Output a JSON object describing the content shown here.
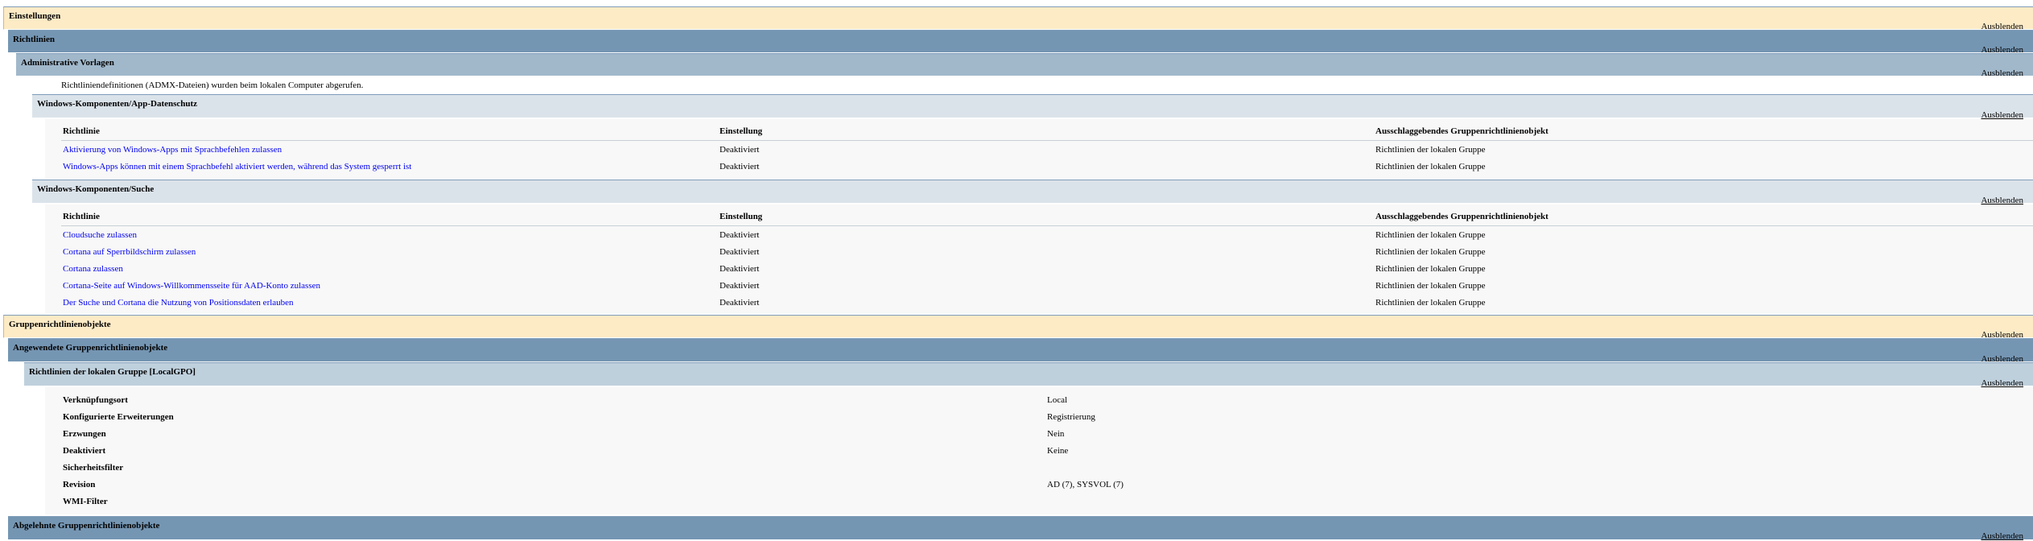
{
  "hide_label": "Ausblenden",
  "settings": {
    "title": "Einstellungen",
    "policies": {
      "title": "Richtlinien",
      "admin_templates": {
        "title": "Administrative Vorlagen",
        "note": "Richtliniendefinitionen (ADMX-Dateien) wurden beim lokalen Computer abgerufen.",
        "groups": [
          {
            "title": "Windows-Komponenten/App-Datenschutz",
            "columns": [
              "Richtlinie",
              "Einstellung",
              "Ausschlaggebendes Gruppenrichtlinienobjekt"
            ],
            "rows": [
              {
                "policy": "Aktivierung von Windows-Apps mit Sprachbefehlen zulassen",
                "setting": "Deaktiviert",
                "gpo": "Richtlinien der lokalen Gruppe"
              },
              {
                "policy": "Windows-Apps können mit einem Sprachbefehl aktiviert werden, während das System gesperrt ist",
                "setting": "Deaktiviert",
                "gpo": "Richtlinien der lokalen Gruppe"
              }
            ]
          },
          {
            "title": "Windows-Komponenten/Suche",
            "columns": [
              "Richtlinie",
              "Einstellung",
              "Ausschlaggebendes Gruppenrichtlinienobjekt"
            ],
            "rows": [
              {
                "policy": "Cloudsuche zulassen",
                "setting": "Deaktiviert",
                "gpo": "Richtlinien der lokalen Gruppe"
              },
              {
                "policy": "Cortana auf Sperrbildschirm zulassen",
                "setting": "Deaktiviert",
                "gpo": "Richtlinien der lokalen Gruppe"
              },
              {
                "policy": "Cortana zulassen",
                "setting": "Deaktiviert",
                "gpo": "Richtlinien der lokalen Gruppe"
              },
              {
                "policy": "Cortana-Seite auf Windows-Willkommensseite für AAD-Konto zulassen",
                "setting": "Deaktiviert",
                "gpo": "Richtlinien der lokalen Gruppe"
              },
              {
                "policy": "Der Suche und Cortana die Nutzung von Positionsdaten erlauben",
                "setting": "Deaktiviert",
                "gpo": "Richtlinien der lokalen Gruppe"
              }
            ]
          }
        ]
      }
    }
  },
  "gpos": {
    "title": "Gruppenrichtlinienobjekte",
    "applied": {
      "title": "Angewendete Gruppenrichtlinienobjekte",
      "local": {
        "title": "Richtlinien der lokalen Gruppe [LocalGPO]",
        "props": [
          {
            "label": "Verknüpfungsort",
            "value": "Local"
          },
          {
            "label": "Konfigurierte Erweiterungen",
            "value": "Registrierung"
          },
          {
            "label": "Erzwungen",
            "value": "Nein"
          },
          {
            "label": "Deaktiviert",
            "value": "Keine"
          },
          {
            "label": "Sicherheitsfilter",
            "value": ""
          },
          {
            "label": "Revision",
            "value": "AD (7), SYSVOL (7)"
          },
          {
            "label": "WMI-Filter",
            "value": ""
          }
        ]
      }
    },
    "denied": {
      "title": "Abgelehnte Gruppenrichtlinienobjekte"
    }
  },
  "colors": {
    "level1": "#fdebc6",
    "level2": "#7596b3",
    "level3": "#a1b8cb",
    "level4": "#dbe3ea",
    "link": "#0000ee"
  }
}
